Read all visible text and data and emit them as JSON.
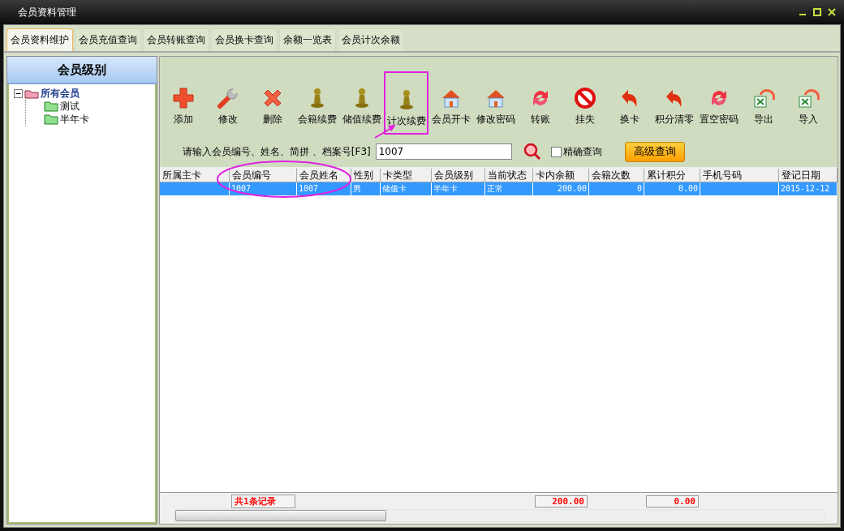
{
  "window": {
    "title": "会员资料管理"
  },
  "tabs": [
    {
      "label": "会员资料维护",
      "selected": true
    },
    {
      "label": "会员充值查询",
      "selected": false
    },
    {
      "label": "会员转账查询",
      "selected": false
    },
    {
      "label": "会员换卡查询",
      "selected": false
    },
    {
      "label": "余额一览表",
      "selected": false
    },
    {
      "label": "会员计次余额",
      "selected": false
    }
  ],
  "sidebar": {
    "title": "会员级别",
    "tree": [
      {
        "label": "所有会员",
        "expanded": true,
        "children": [
          {
            "label": "测试"
          },
          {
            "label": "半年卡"
          }
        ]
      }
    ]
  },
  "toolbar": [
    {
      "label": "添加",
      "kind": "add",
      "highlighted": false
    },
    {
      "label": "修改",
      "kind": "edit",
      "highlighted": false
    },
    {
      "label": "删除",
      "kind": "delete",
      "highlighted": false
    },
    {
      "label": "会籍续费",
      "kind": "pawn",
      "highlighted": false
    },
    {
      "label": "储值续费",
      "kind": "pawn",
      "highlighted": false
    },
    {
      "label": "计次续费",
      "kind": "pawn",
      "highlighted": true
    },
    {
      "label": "会员开卡",
      "kind": "house",
      "highlighted": false
    },
    {
      "label": "修改密码",
      "kind": "house",
      "highlighted": false
    },
    {
      "label": "转账",
      "kind": "transfer",
      "highlighted": false
    },
    {
      "label": "挂失",
      "kind": "ban",
      "highlighted": false
    },
    {
      "label": "换卡",
      "kind": "curl",
      "highlighted": false
    },
    {
      "label": "积分清零",
      "kind": "curl",
      "highlighted": false
    },
    {
      "label": "置空密码",
      "kind": "transfer",
      "highlighted": false
    },
    {
      "label": "导出",
      "kind": "excel",
      "highlighted": false
    },
    {
      "label": "导入",
      "kind": "excel",
      "highlighted": false
    }
  ],
  "search": {
    "label": "请输入会员编号、姓名、简拼 、档案号[F3]",
    "value": "1007",
    "exact_match": {
      "label": "精确查询",
      "checked": false
    },
    "advanced_button": "高级查询"
  },
  "table": {
    "columns": [
      "所属主卡",
      "会员编号",
      "会员姓名",
      "性别",
      "卡类型",
      "会员级别",
      "当前状态",
      "卡内余额",
      "会籍次数",
      "累计积分",
      "手机号码",
      "登记日期"
    ],
    "rows": [
      {
        "selected": true,
        "cells": [
          "",
          "1007",
          "1007",
          "男",
          "储值卡",
          "半年卡",
          "正常",
          "200.00",
          "0",
          "0.00",
          "",
          "2015-12-12"
        ]
      }
    ]
  },
  "footer": {
    "count": "共1条记录",
    "balance": "200.00",
    "points": "0.00"
  }
}
